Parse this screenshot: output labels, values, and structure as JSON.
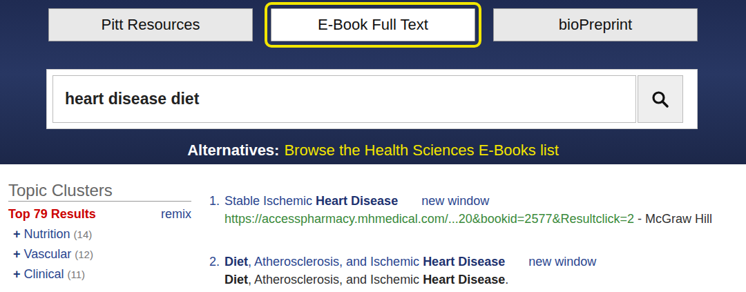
{
  "tabs": [
    {
      "label": "Pitt Resources",
      "selected": false
    },
    {
      "label": "E-Book Full Text",
      "selected": true
    },
    {
      "label": "bioPreprint",
      "selected": false
    }
  ],
  "search": {
    "value": "heart disease diet"
  },
  "alternatives": {
    "label": "Alternatives:",
    "link": "Browse the Health Sciences E-Books list"
  },
  "sidebar": {
    "title": "Topic Clusters",
    "top": "Top 79 Results",
    "remix": "remix",
    "items": [
      {
        "sign": "+",
        "label": "Nutrition",
        "count": "(14)"
      },
      {
        "sign": "+",
        "label": "Vascular",
        "count": "(12)"
      },
      {
        "sign": "+",
        "label": "Clinical",
        "count": "(11)"
      }
    ]
  },
  "results": [
    {
      "number": "1.",
      "title": [
        {
          "text": "Stable Ischemic ",
          "bold": false
        },
        {
          "text": "Heart Disease",
          "bold": true
        }
      ],
      "newWindow": "new window",
      "url": "https://accesspharmacy.mhmedical.com/...20&bookid=2577&Resultclick=2",
      "source": "- McGraw Hill",
      "description": []
    },
    {
      "number": "2.",
      "title": [
        {
          "text": "Diet",
          "bold": true
        },
        {
          "text": ", Atherosclerosis, and Ischemic ",
          "bold": false
        },
        {
          "text": "Heart Disease",
          "bold": true
        }
      ],
      "newWindow": "new window",
      "url": "",
      "source": "",
      "description": [
        {
          "text": "Diet",
          "bold": true
        },
        {
          "text": ", Atherosclerosis, and Ischemic ",
          "bold": false
        },
        {
          "text": "Heart Disease",
          "bold": true
        },
        {
          "text": ".",
          "bold": false
        }
      ]
    }
  ]
}
